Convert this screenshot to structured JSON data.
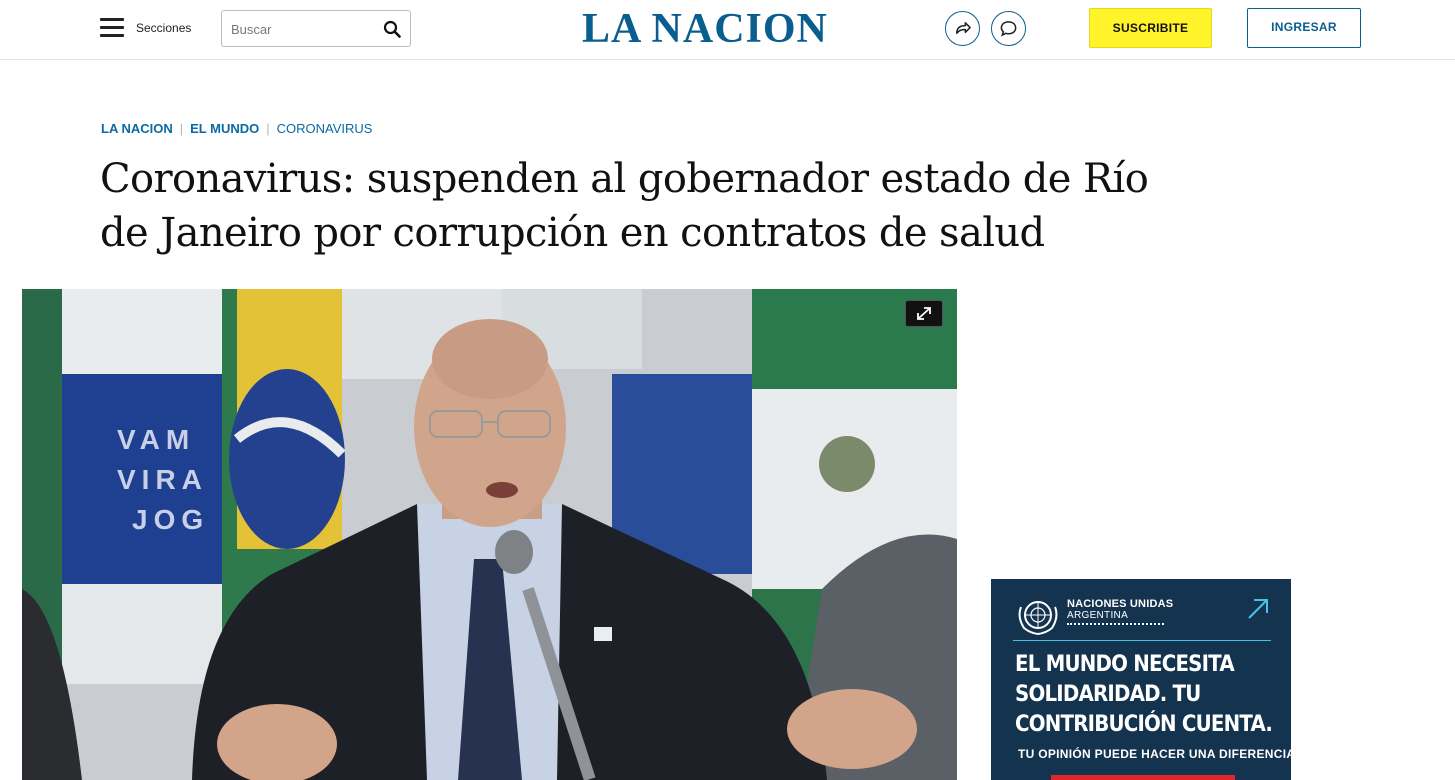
{
  "header": {
    "menu_label": "Secciones",
    "search_placeholder": "Buscar",
    "logo": "LA NACION",
    "subscribe_label": "SUSCRIBITE",
    "login_label": "INGRESAR"
  },
  "breadcrumb": [
    "LA NACION",
    "EL MUNDO",
    "CORONAVIRUS"
  ],
  "article": {
    "title": "Coronavirus: suspenden al gobernador estado de Río de Janeiro por corrupción en contratos de salud"
  },
  "ad": {
    "org_name": "NACIONES UNIDAS",
    "org_country": "ARGENTINA",
    "headline_lines": [
      "EL MUNDO NECESITA",
      "SOLIDARIDAD. TU",
      "CONTRIBUCIÓN CUENTA."
    ],
    "subline": "TU OPINIÓN PUEDE HACER UNA DIFERENCIA"
  },
  "colors": {
    "brand_blue": "#0a5e8f",
    "subscribe_yellow": "#fff32a",
    "ad_background": "#14334e"
  }
}
